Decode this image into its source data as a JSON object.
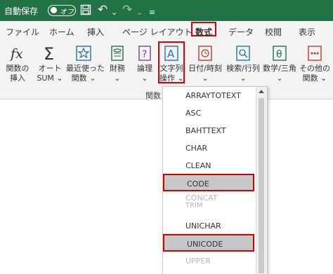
{
  "titlebar": {
    "title": "自動保存",
    "autosave_state": "オフ",
    "save_icon": "save-icon",
    "undo_icon": "undo-icon",
    "redo_icon": "redo-icon",
    "customize_icon": "customize-qat-icon"
  },
  "tabs": [
    "ファイル",
    "ホーム",
    "挿入",
    "ページ レイアウト",
    "数式",
    "データ",
    "校閲",
    "表示"
  ],
  "active_tab": "数式",
  "ribbon": {
    "buttons": [
      {
        "line1": "関数の",
        "line2": "挿入",
        "icon": "function-icon"
      },
      {
        "line1": "オート",
        "line2": "SUM ⌄",
        "icon": "sigma-icon"
      },
      {
        "line1": "最近使った",
        "line2": "関数 ⌄",
        "icon": "star-icon"
      },
      {
        "line1": "財務",
        "line2": "⌄",
        "icon": "finance-icon"
      },
      {
        "line1": "論理",
        "line2": "⌄",
        "icon": "logical-icon"
      },
      {
        "line1": "文字列",
        "line2": "操作 ⌄",
        "icon": "text-icon"
      },
      {
        "line1": "日付/時刻",
        "line2": "⌄",
        "icon": "clock-icon"
      },
      {
        "line1": "検索/行列",
        "line2": "⌄",
        "icon": "lookup-icon"
      },
      {
        "line1": "数学/三角",
        "line2": "⌄",
        "icon": "math-icon"
      },
      {
        "line1": "その他の",
        "line2": "関数 ⌄",
        "icon": "more-functions-icon"
      }
    ],
    "group_label": "関数"
  },
  "dropdown": {
    "items": [
      "ARRAYTOTEXT",
      "ASC",
      "BAHTTEXT",
      "CHAR",
      "CLEAN",
      "CODE",
      "CONCAT",
      "TRIM",
      "UNICHAR",
      "UNICODE",
      "UPPER"
    ],
    "selected": [
      "CODE",
      "UNICODE"
    ]
  },
  "colors": {
    "titlebar": "#217346",
    "highlight": "#e00000",
    "selected_bg": "#c7c7c7"
  }
}
